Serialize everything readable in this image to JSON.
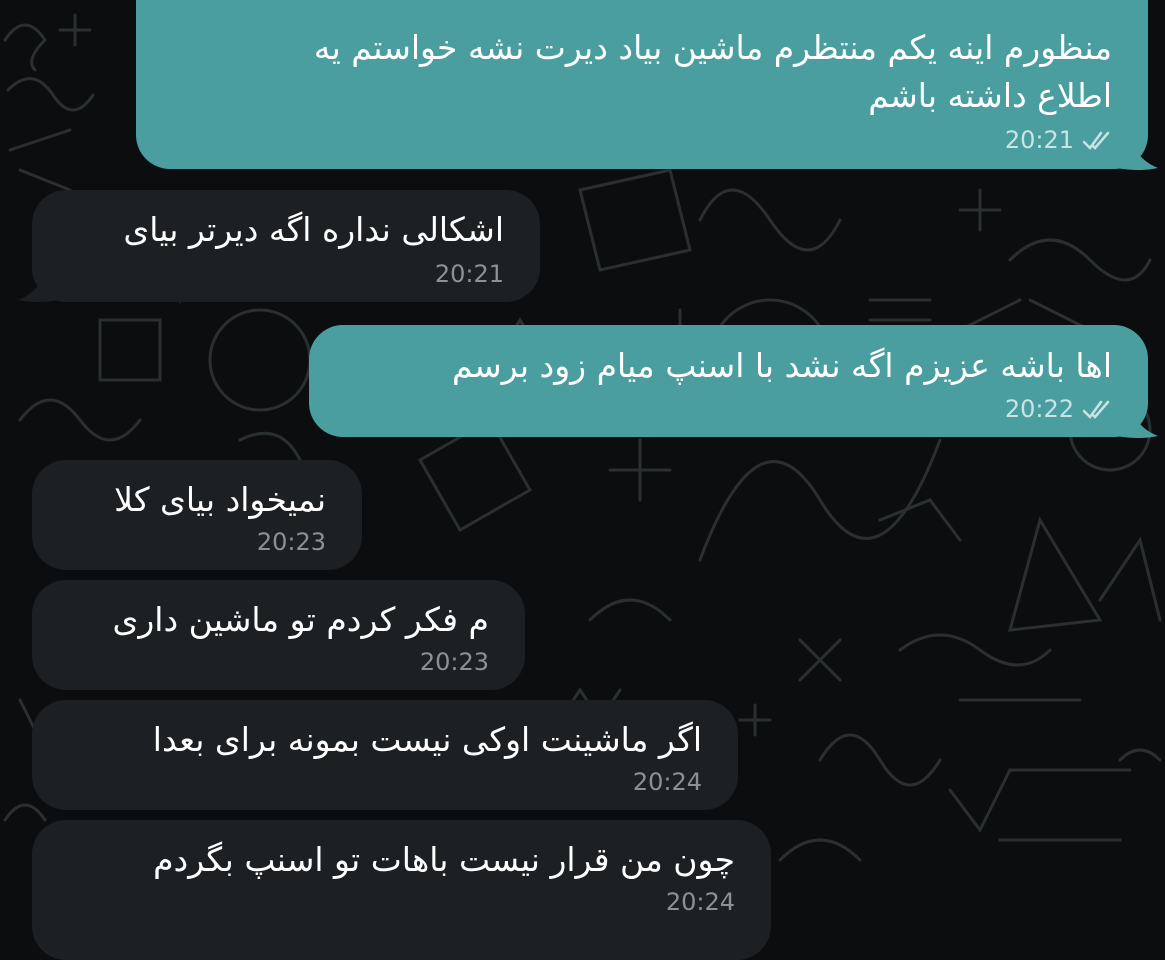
{
  "chat": {
    "colors": {
      "outgoing_bubble": "#4a9ea0",
      "incoming_bubble": "#1d2022",
      "wallpaper": "#0b0d0e",
      "doodle": "#2a3032"
    },
    "messages": [
      {
        "direction": "outgoing",
        "lines": [
          "منظورم اینه یکم منتظرم ماشین بیاد دیرت نشه خواستم یه",
          "اطلاع داشته باشم"
        ],
        "time": "20:21",
        "status_icon": "double-check-icon"
      },
      {
        "direction": "incoming",
        "lines": [
          "اشکالی نداره اگه دیرتر  بیای"
        ],
        "time": "20:21"
      },
      {
        "direction": "outgoing",
        "lines": [
          "اها باشه عزیزم اگه نشد با اسنپ میام زود برسم"
        ],
        "time": "20:22",
        "status_icon": "double-check-icon"
      },
      {
        "direction": "incoming",
        "lines": [
          "نمیخواد بیای کلا"
        ],
        "time": "20:23"
      },
      {
        "direction": "incoming",
        "lines": [
          "م فکر کردم تو ماشین داری"
        ],
        "time": "20:23"
      },
      {
        "direction": "incoming",
        "lines": [
          "اگر ماشینت اوکی نیست بمونه برای بعدا"
        ],
        "time": "20:24"
      },
      {
        "direction": "incoming",
        "lines": [
          "چون من قرار نیست باهات تو اسنپ بگردم"
        ],
        "time": "20:24"
      }
    ]
  }
}
